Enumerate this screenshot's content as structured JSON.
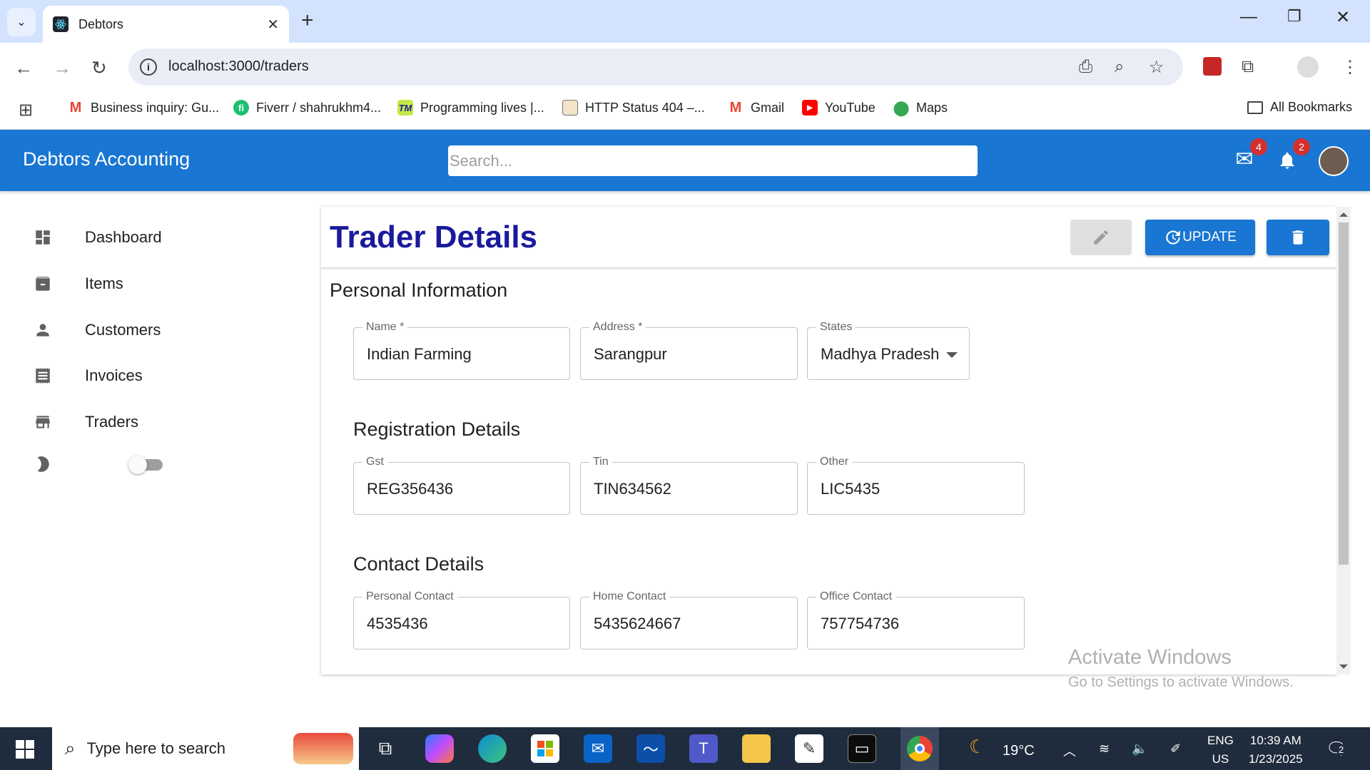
{
  "browser": {
    "tab_title": "Debtors",
    "url": "localhost:3000/traders",
    "bookmarks": [
      {
        "label": "Business inquiry: Gu...",
        "icon": "gmail-icon"
      },
      {
        "label": "Fiverr / shahrukhm4...",
        "icon": "fiverr-icon"
      },
      {
        "label": "Programming lives |...",
        "icon": "tm-icon"
      },
      {
        "label": "HTTP Status 404 –...",
        "icon": "image-icon"
      },
      {
        "label": "Gmail",
        "icon": "gmail-icon"
      },
      {
        "label": "YouTube",
        "icon": "youtube-icon"
      },
      {
        "label": "Maps",
        "icon": "maps-icon"
      }
    ],
    "all_bookmarks": "All Bookmarks"
  },
  "appbar": {
    "brand": "Debtors Accounting",
    "search_placeholder": "Search...",
    "mail_count": "4",
    "notification_count": "2"
  },
  "sidebar": {
    "items": [
      {
        "label": "Dashboard",
        "icon": "dashboard-icon"
      },
      {
        "label": "Items",
        "icon": "archive-icon"
      },
      {
        "label": "Customers",
        "icon": "person-icon"
      },
      {
        "label": "Invoices",
        "icon": "receipt-icon"
      },
      {
        "label": "Traders",
        "icon": "store-icon"
      }
    ],
    "dark_mode_on": false
  },
  "main": {
    "title": "Trader Details",
    "update_label": "UPDATE",
    "personal": {
      "heading": "Personal Information",
      "name_label": "Name *",
      "name_value": "Indian Farming",
      "address_label": "Address *",
      "address_value": "Sarangpur",
      "states_label": "States",
      "states_value": "Madhya Pradesh"
    },
    "registration": {
      "heading": "Registration Details",
      "gst_label": "Gst",
      "gst_value": "REG356436",
      "tin_label": "Tin",
      "tin_value": "TIN634562",
      "other_label": "Other",
      "other_value": "LIC5435"
    },
    "contact": {
      "heading": "Contact Details",
      "personal_label": "Personal Contact",
      "personal_value": "4535436",
      "home_label": "Home Contact",
      "home_value": "5435624667",
      "office_label": "Office Contact",
      "office_value": "757754736"
    }
  },
  "watermark": {
    "line1": "Activate Windows",
    "line2": "Go to Settings to activate Windows."
  },
  "taskbar": {
    "search_placeholder": "Type here to search",
    "weather": "19°C",
    "lang_line1": "ENG",
    "lang_line2": "US",
    "time": "10:39 AM",
    "date": "1/23/2025",
    "notification_count": "2"
  },
  "colors": {
    "primary": "#1976d2",
    "title": "#1a1a9c",
    "taskbar": "#1f2c3d"
  }
}
